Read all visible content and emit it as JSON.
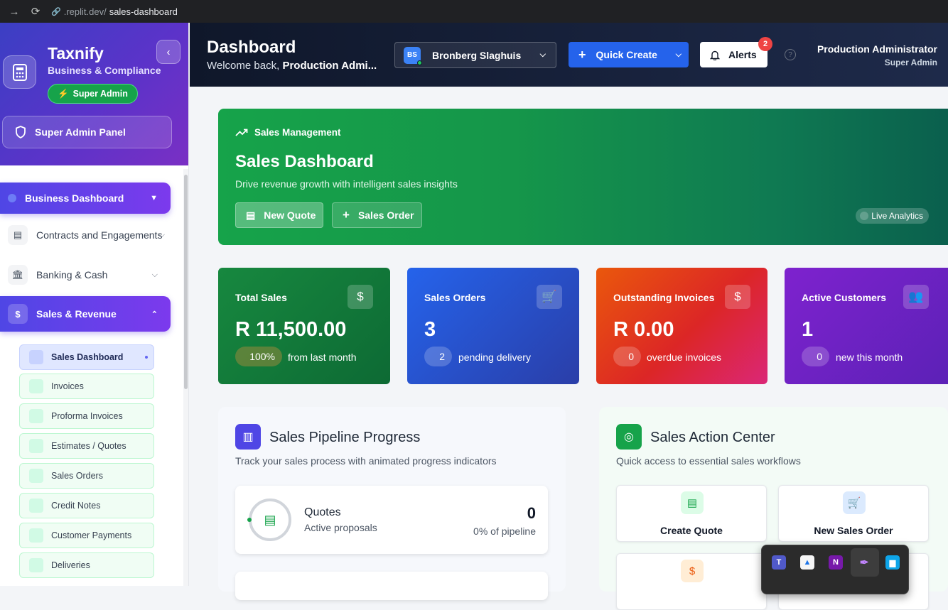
{
  "browser": {
    "url_host": ".replit.dev/",
    "url_path": "sales-dashboard"
  },
  "sidebar": {
    "brand": "Taxnify",
    "brand_sub": "Business & Compliance",
    "badge": "Super Admin",
    "panel_button": "Super Admin Panel",
    "items": [
      {
        "label": "Business Dashboard",
        "active": true
      },
      {
        "label": "Contracts and Engagements"
      },
      {
        "label": "Banking & Cash"
      },
      {
        "label": "Sales & Revenue",
        "active": true,
        "expanded": true
      }
    ],
    "subitems": [
      "Sales Dashboard",
      "Invoices",
      "Proforma Invoices",
      "Estimates / Quotes",
      "Sales Orders",
      "Credit Notes",
      "Customer Payments",
      "Deliveries"
    ],
    "current_subitem": "Sales Dashboard"
  },
  "header": {
    "title": "Dashboard",
    "welcome_prefix": "Welcome back, ",
    "welcome_name": "Production Admi...",
    "company_initials": "BS",
    "company_name": "Bronberg Slaghuis",
    "quick_create": "Quick Create",
    "alerts": "Alerts",
    "alerts_count": "2",
    "user_name": "Production Administrator",
    "user_role": "Super Admin"
  },
  "hero": {
    "tag": "Sales Management",
    "title": "Sales Dashboard",
    "subtitle": "Drive revenue growth with intelligent sales insights",
    "btn_quote": "New Quote",
    "btn_order": "Sales Order",
    "live": "Live Analytics",
    "colors": [
      "#16a34a",
      "#0a5e4d"
    ]
  },
  "stats": [
    {
      "label": "Total Sales",
      "value": "R 11,500.00",
      "pill": "100%",
      "note": "from last month",
      "icon": "dollar-icon",
      "color": "#15803d"
    },
    {
      "label": "Sales Orders",
      "value": "3",
      "pill": "2",
      "note": "pending delivery",
      "icon": "cart-icon",
      "color": "#2563eb"
    },
    {
      "label": "Outstanding Invoices",
      "value": "R 0.00",
      "pill": "0",
      "note": "overdue invoices",
      "icon": "invoice-dollar-icon",
      "color": "#dc2626"
    },
    {
      "label": "Active Customers",
      "value": "1",
      "pill": "0",
      "note": "new this month",
      "icon": "users-icon",
      "color": "#7e22ce"
    }
  ],
  "pipeline": {
    "title": "Sales Pipeline Progress",
    "subtitle": "Track your sales process with animated progress indicators",
    "rows": [
      {
        "title": "Quotes",
        "sub": "Active proposals",
        "value": "0",
        "pct": "0% of pipeline"
      }
    ]
  },
  "actions": {
    "title": "Sales Action Center",
    "subtitle": "Quick access to essential sales workflows",
    "items": [
      "Create Quote",
      "New Sales Order"
    ]
  }
}
